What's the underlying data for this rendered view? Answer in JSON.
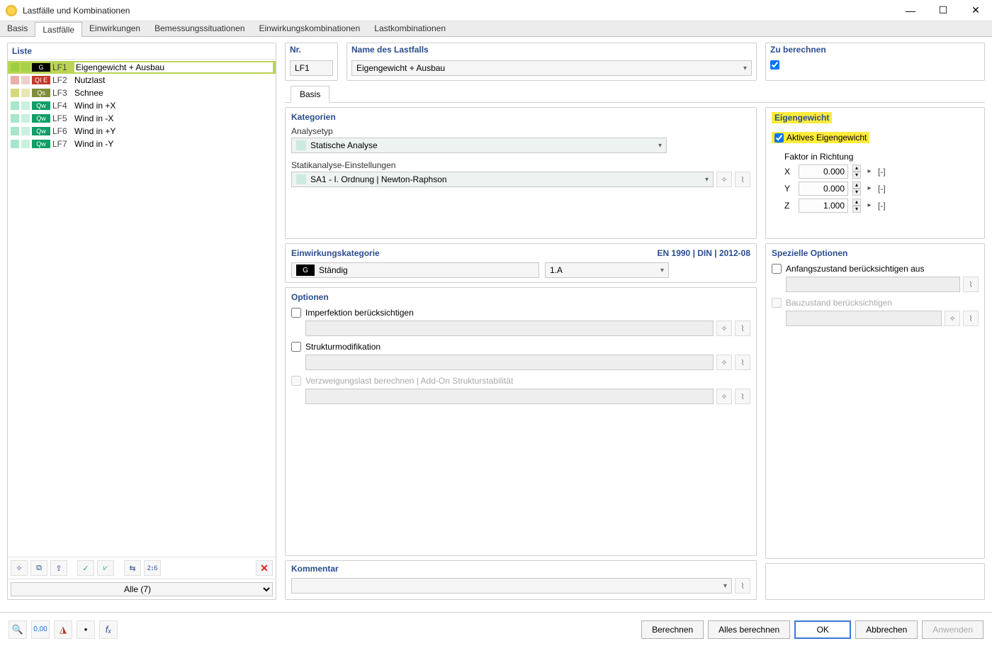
{
  "window": {
    "title": "Lastfälle und Kombinationen"
  },
  "topTabs": [
    "Basis",
    "Lastfälle",
    "Einwirkungen",
    "Bemessungssituationen",
    "Einwirkungskombinationen",
    "Lastkombinationen"
  ],
  "activeTopTab": 1,
  "leftPanel": {
    "title": "Liste",
    "filter": "Alle (7)",
    "items": [
      {
        "catColor": "#000000",
        "catText": "G",
        "swatch": "#9ccf3e",
        "num": "LF1",
        "name": "Eigengewicht + Ausbau",
        "active": true
      },
      {
        "catColor": "#c0392b",
        "catText": "QI E",
        "swatch": "#e6b0aa",
        "num": "LF2",
        "name": "Nutzlast",
        "active": false
      },
      {
        "catColor": "#7f8c3a",
        "catText": "Qs",
        "swatch": "#d6d97a",
        "num": "LF3",
        "name": "Schnee",
        "active": false
      },
      {
        "catColor": "#0f9e66",
        "catText": "Qw",
        "swatch": "#a6e6c9",
        "num": "LF4",
        "name": "Wind in +X",
        "active": false
      },
      {
        "catColor": "#0f9e66",
        "catText": "Qw",
        "swatch": "#a6e6c9",
        "num": "LF5",
        "name": "Wind in -X",
        "active": false
      },
      {
        "catColor": "#0f9e66",
        "catText": "Qw",
        "swatch": "#a6e6c9",
        "num": "LF6",
        "name": "Wind in +Y",
        "active": false
      },
      {
        "catColor": "#0f9e66",
        "catText": "Qw",
        "swatch": "#a6e6c9",
        "num": "LF7",
        "name": "Wind in -Y",
        "active": false
      }
    ]
  },
  "nr": {
    "label": "Nr.",
    "value": "LF1"
  },
  "name": {
    "label": "Name des Lastfalls",
    "value": "Eigengewicht + Ausbau"
  },
  "calc": {
    "label": "Zu berechnen",
    "checked": true
  },
  "subTab": "Basis",
  "kategorien": {
    "title": "Kategorien",
    "analysetypLabel": "Analysetyp",
    "analysetypValue": "Statische Analyse",
    "statikLabel": "Statikanalyse-Einstellungen",
    "statikValue": "SA1 - I. Ordnung | Newton-Raphson"
  },
  "einwirkung": {
    "title": "Einwirkungskategorie",
    "norm": "EN 1990 | DIN | 2012-08",
    "badge": "G",
    "value": "Ständig",
    "class": "1.A"
  },
  "optionen": {
    "title": "Optionen",
    "imperfektion": "Imperfektion berücksichtigen",
    "struktur": "Strukturmodifikation",
    "verzweig": "Verzweigungslast berechnen | Add-On Strukturstabilität"
  },
  "eigengewicht": {
    "title": "Eigengewicht",
    "aktiv": "Aktives Eigengewicht",
    "faktorLabel": "Faktor in Richtung",
    "rows": [
      {
        "axis": "X",
        "value": "0.000",
        "unit": "[-]"
      },
      {
        "axis": "Y",
        "value": "0.000",
        "unit": "[-]"
      },
      {
        "axis": "Z",
        "value": "1.000",
        "unit": "[-]"
      }
    ]
  },
  "spezielle": {
    "title": "Spezielle Optionen",
    "anfang": "Anfangszustand berücksichtigen aus",
    "bauz": "Bauzustand berücksichtigen"
  },
  "kommentar": {
    "title": "Kommentar",
    "value": ""
  },
  "buttons": {
    "berechnen": "Berechnen",
    "alles": "Alles berechnen",
    "ok": "OK",
    "abbrechen": "Abbrechen",
    "anwenden": "Anwenden"
  }
}
